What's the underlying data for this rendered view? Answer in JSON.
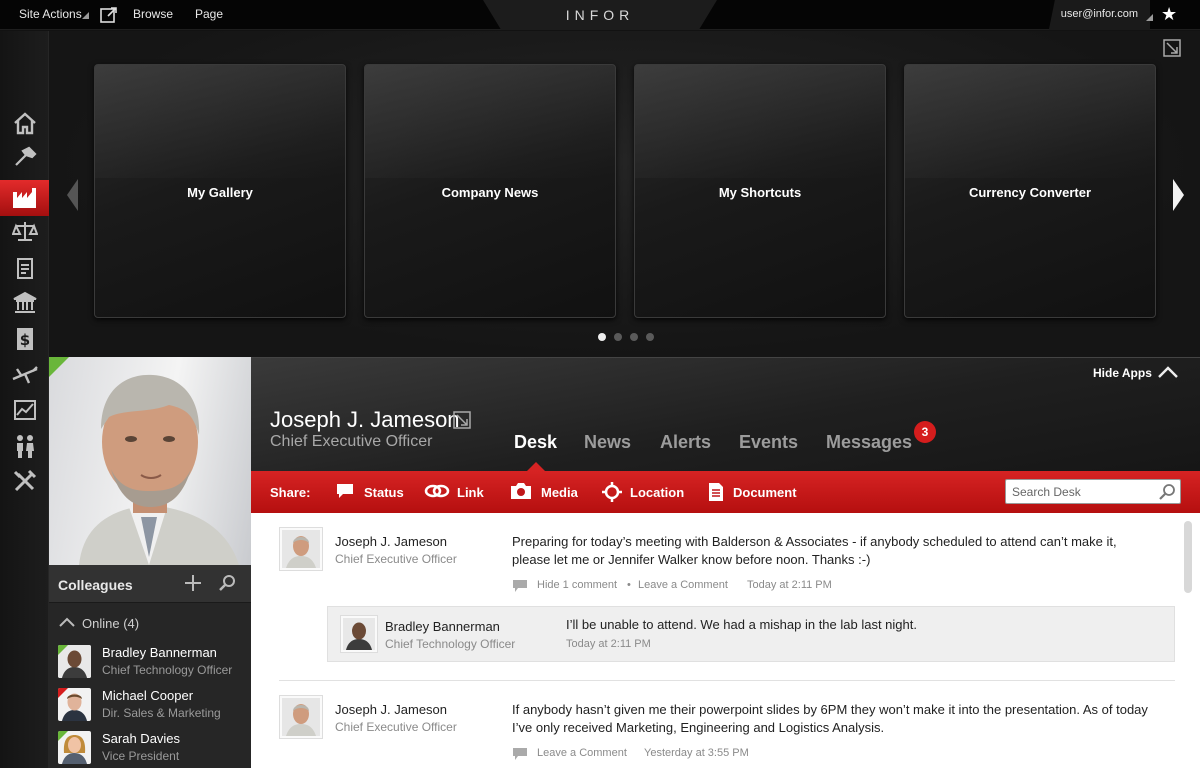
{
  "topbar": {
    "site_actions": "Site Actions",
    "browse": "Browse",
    "page": "Page",
    "logo": "INFOR",
    "user": "user@infor.com"
  },
  "rail": {
    "icons": [
      "home-icon",
      "hammer-icon",
      "factory-icon",
      "scales-icon",
      "clipboard-icon",
      "bank-icon",
      "dollar-icon",
      "plane-icon",
      "chart-icon",
      "people-icon",
      "tools-icon"
    ],
    "active": "factory-icon"
  },
  "apps": {
    "tiles": [
      {
        "label": "My Gallery"
      },
      {
        "label": "Company News"
      },
      {
        "label": "My Shortcuts"
      },
      {
        "label": "Currency Converter"
      }
    ],
    "page_count": 4,
    "current_page": 1
  },
  "profile": {
    "name": "Joseph J. Jameson",
    "title": "Chief Executive Officer",
    "hide_apps": "Hide Apps"
  },
  "tabs": [
    {
      "label": "Desk",
      "active": true
    },
    {
      "label": "News"
    },
    {
      "label": "Alerts"
    },
    {
      "label": "Events"
    },
    {
      "label": "Messages",
      "badge": "3"
    }
  ],
  "share": {
    "label": "Share:",
    "items": [
      "Status",
      "Link",
      "Media",
      "Location",
      "Document"
    ],
    "search_placeholder": "Search Desk"
  },
  "colleagues": {
    "title": "Colleagues",
    "online_label": "Online (4)",
    "people": [
      {
        "name": "Bradley Bannerman",
        "role": "Chief Technology Officer"
      },
      {
        "name": "Michael Cooper",
        "role": "Dir. Sales & Marketing"
      },
      {
        "name": "Sarah Davies",
        "role": "Vice President"
      }
    ]
  },
  "feed": {
    "posts": [
      {
        "name": "Joseph J. Jameson",
        "role": "Chief Executive Officer",
        "text": "Preparing for today’s meeting with Balderson & Associates - if anybody scheduled to attend can’t make it, please let me or Jennifer Walker know before noon. Thanks :-)",
        "hide_comment": "Hide 1 comment",
        "sep": "•",
        "leave": "Leave a Comment",
        "time": "Today at 2:11 PM"
      },
      {
        "name": "Joseph J. Jameson",
        "role": "Chief Executive Officer",
        "text": "If anybody hasn’t given me their powerpoint slides by 6PM they won’t make it into the presentation. As of today I’ve only received Marketing, Engineering and Logistics Analysis.",
        "leave": "Leave a Comment",
        "time": "Yesterday at 3:55 PM"
      }
    ],
    "reply": {
      "name": "Bradley Bannerman",
      "role": "Chief Technology Officer",
      "text": "I’ll be unable to attend. We had a mishap in the lab last night.",
      "time": "Today at 2:11 PM"
    }
  }
}
